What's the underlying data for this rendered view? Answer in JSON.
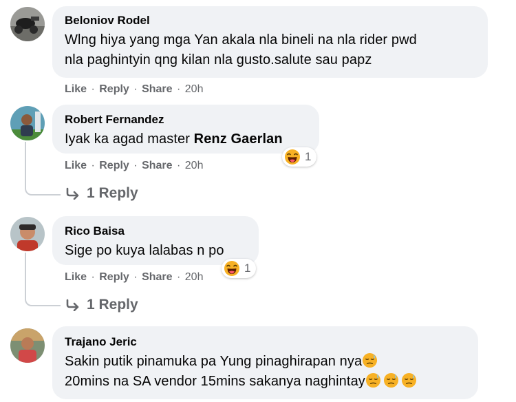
{
  "comments": [
    {
      "author": "Beloniov Rodel",
      "text_line1": "Wlng hiya yang mga Yan akala nla bineli na nla rider pwd",
      "text_line2": "nla paghintyin qng kilan nla gusto.salute sau papz",
      "actions": {
        "like": "Like",
        "reply": "Reply",
        "share": "Share",
        "time": "20h"
      }
    },
    {
      "author": "Robert Fernandez",
      "text": "Iyak ka agad master ",
      "mention": "Renz Gaerlan",
      "reaction_count": "1",
      "actions": {
        "like": "Like",
        "reply": "Reply",
        "share": "Share",
        "time": "20h"
      },
      "replies": "1 Reply"
    },
    {
      "author": "Rico Baisa",
      "text": "Sige po kuya lalabas n po",
      "reaction_count": "1",
      "actions": {
        "like": "Like",
        "reply": "Reply",
        "share": "Share",
        "time": "20h"
      },
      "replies": "1 Reply"
    },
    {
      "author": "Trajano Jeric",
      "text_line1": "Sakin putik pinamuka pa Yung pinaghirapan nya",
      "text_line2": "20mins na SA vendor 15mins sakanya naghintay"
    }
  ],
  "separator": "·",
  "colors": {
    "bubble": "#f0f2f5",
    "secondary_text": "#65676b",
    "reaction_yellow": "#f7b125"
  },
  "icons": {
    "reaction": "laughing-face-emoji",
    "inline": "downcast-sweat-face-emoji",
    "reply_arrow": "reply-arrow-icon"
  }
}
